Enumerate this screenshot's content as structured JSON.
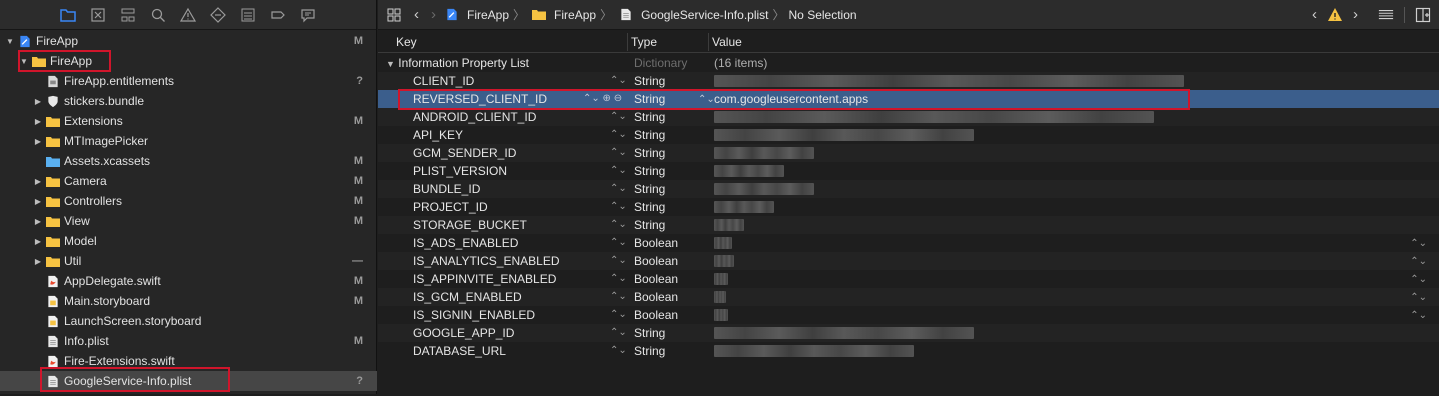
{
  "navigator": {
    "toolbar_icons": [
      "folder-icon",
      "source-control-icon",
      "hierarchy-icon",
      "search-icon",
      "warning-icon",
      "diamond-icon",
      "list-icon",
      "tag-icon",
      "comment-icon"
    ],
    "project": {
      "name": "FireApp",
      "badge": "M"
    },
    "items": [
      {
        "label": "FireApp",
        "badge": "",
        "kind": "folder",
        "disclosure": "open"
      },
      {
        "label": "FireApp.entitlements",
        "badge": "?",
        "kind": "entitlements-file"
      },
      {
        "label": "stickers.bundle",
        "badge": "",
        "kind": "bundle",
        "disclosure": "closed"
      },
      {
        "label": "Extensions",
        "badge": "M",
        "kind": "folder",
        "disclosure": "closed"
      },
      {
        "label": "MTImagePicker",
        "badge": "",
        "kind": "folder",
        "disclosure": "closed"
      },
      {
        "label": "Assets.xcassets",
        "badge": "M",
        "kind": "assets"
      },
      {
        "label": "Camera",
        "badge": "M",
        "kind": "folder",
        "disclosure": "closed"
      },
      {
        "label": "Controllers",
        "badge": "M",
        "kind": "folder",
        "disclosure": "closed"
      },
      {
        "label": "View",
        "badge": "M",
        "kind": "folder",
        "disclosure": "closed"
      },
      {
        "label": "Model",
        "badge": "",
        "kind": "folder",
        "disclosure": "closed"
      },
      {
        "label": "Util",
        "badge": "—",
        "kind": "folder",
        "disclosure": "closed"
      },
      {
        "label": "AppDelegate.swift",
        "badge": "M",
        "kind": "swift-file"
      },
      {
        "label": "Main.storyboard",
        "badge": "M",
        "kind": "storyboard-file"
      },
      {
        "label": "LaunchScreen.storyboard",
        "badge": "",
        "kind": "storyboard-file"
      },
      {
        "label": "Info.plist",
        "badge": "M",
        "kind": "plist-file"
      },
      {
        "label": "Fire-Extensions.swift",
        "badge": "",
        "kind": "swift-file"
      },
      {
        "label": "GoogleService-Info.plist",
        "badge": "?",
        "kind": "plist-file",
        "selected": true
      }
    ]
  },
  "jump_bar": {
    "crumbs": [
      "FireApp",
      "FireApp",
      "GoogleService-Info.plist",
      "No Selection"
    ]
  },
  "plist": {
    "columns": {
      "key": "Key",
      "type": "Type",
      "value": "Value"
    },
    "root": {
      "key": "Information Property List",
      "type": "Dictionary",
      "value": "(16 items)"
    },
    "rows": [
      {
        "key": "CLIENT_ID",
        "type": "String",
        "value": ""
      },
      {
        "key": "REVERSED_CLIENT_ID",
        "type": "String",
        "value": "com.googleusercontent.apps"
      },
      {
        "key": "ANDROID_CLIENT_ID",
        "type": "String",
        "value": ""
      },
      {
        "key": "API_KEY",
        "type": "String",
        "value": ""
      },
      {
        "key": "GCM_SENDER_ID",
        "type": "String",
        "value": ""
      },
      {
        "key": "PLIST_VERSION",
        "type": "String",
        "value": ""
      },
      {
        "key": "BUNDLE_ID",
        "type": "String",
        "value": ""
      },
      {
        "key": "PROJECT_ID",
        "type": "String",
        "value": ""
      },
      {
        "key": "STORAGE_BUCKET",
        "type": "String",
        "value": ""
      },
      {
        "key": "IS_ADS_ENABLED",
        "type": "Boolean",
        "value": ""
      },
      {
        "key": "IS_ANALYTICS_ENABLED",
        "type": "Boolean",
        "value": ""
      },
      {
        "key": "IS_APPINVITE_ENABLED",
        "type": "Boolean",
        "value": ""
      },
      {
        "key": "IS_GCM_ENABLED",
        "type": "Boolean",
        "value": ""
      },
      {
        "key": "IS_SIGNIN_ENABLED",
        "type": "Boolean",
        "value": ""
      },
      {
        "key": "GOOGLE_APP_ID",
        "type": "String",
        "value": ""
      },
      {
        "key": "DATABASE_URL",
        "type": "String",
        "value": ""
      }
    ]
  },
  "colors": {
    "accent": "#3b5e8c",
    "highlight_box": "#d0152b",
    "folder": "#f5c242"
  }
}
